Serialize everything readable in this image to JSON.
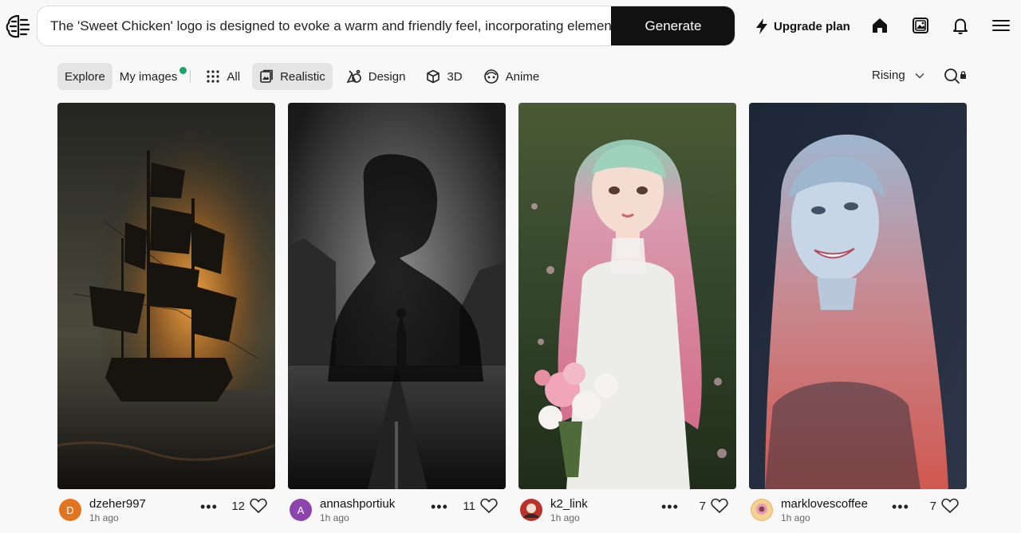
{
  "header": {
    "prompt_value": "The 'Sweet Chicken' logo is designed to evoke a warm and friendly feel, incorporating elements",
    "generate_label": "Generate",
    "upgrade_label": "Upgrade plan",
    "icons": [
      "brain-logo-icon",
      "bolt-icon",
      "home-icon",
      "gallery-icon",
      "bell-icon",
      "menu-icon"
    ]
  },
  "tabs": [
    {
      "label": "Explore",
      "active": true
    },
    {
      "label": "My images",
      "badge": true
    },
    {
      "label": "All",
      "icon": "grid-icon"
    },
    {
      "label": "Realistic",
      "icon": "photo-stack-icon",
      "active": true
    },
    {
      "label": "Design",
      "icon": "design-icon"
    },
    {
      "label": "3D",
      "icon": "cube-icon"
    },
    {
      "label": "Anime",
      "icon": "anime-face-icon"
    }
  ],
  "sort": {
    "label": "Rising",
    "icon": "chevron-down-icon"
  },
  "search": {
    "icon": "search-lock-icon"
  },
  "cards": [
    {
      "user": "dzeher997",
      "ago": "1h ago",
      "likes": "12",
      "avatar_letter": "D",
      "avatar_color": "#e1741f",
      "image": "ghost pirate ship on stormy sea"
    },
    {
      "user": "annashportiuk",
      "ago": "1h ago",
      "likes": "11",
      "avatar_letter": "A",
      "avatar_color": "#8e44ad",
      "image": "double exposure silhouette woman on road"
    },
    {
      "user": "k2_link",
      "ago": "1h ago",
      "likes": "7",
      "avatar_letter": "",
      "avatar_color": "#b9322c",
      "image": "pink haired bride with bouquet"
    },
    {
      "user": "marklovescoffee",
      "ago": "1h ago",
      "likes": "7",
      "avatar_letter": "",
      "avatar_color": "#e8b26a",
      "image": "smiling woman with long red-lit hair"
    }
  ]
}
